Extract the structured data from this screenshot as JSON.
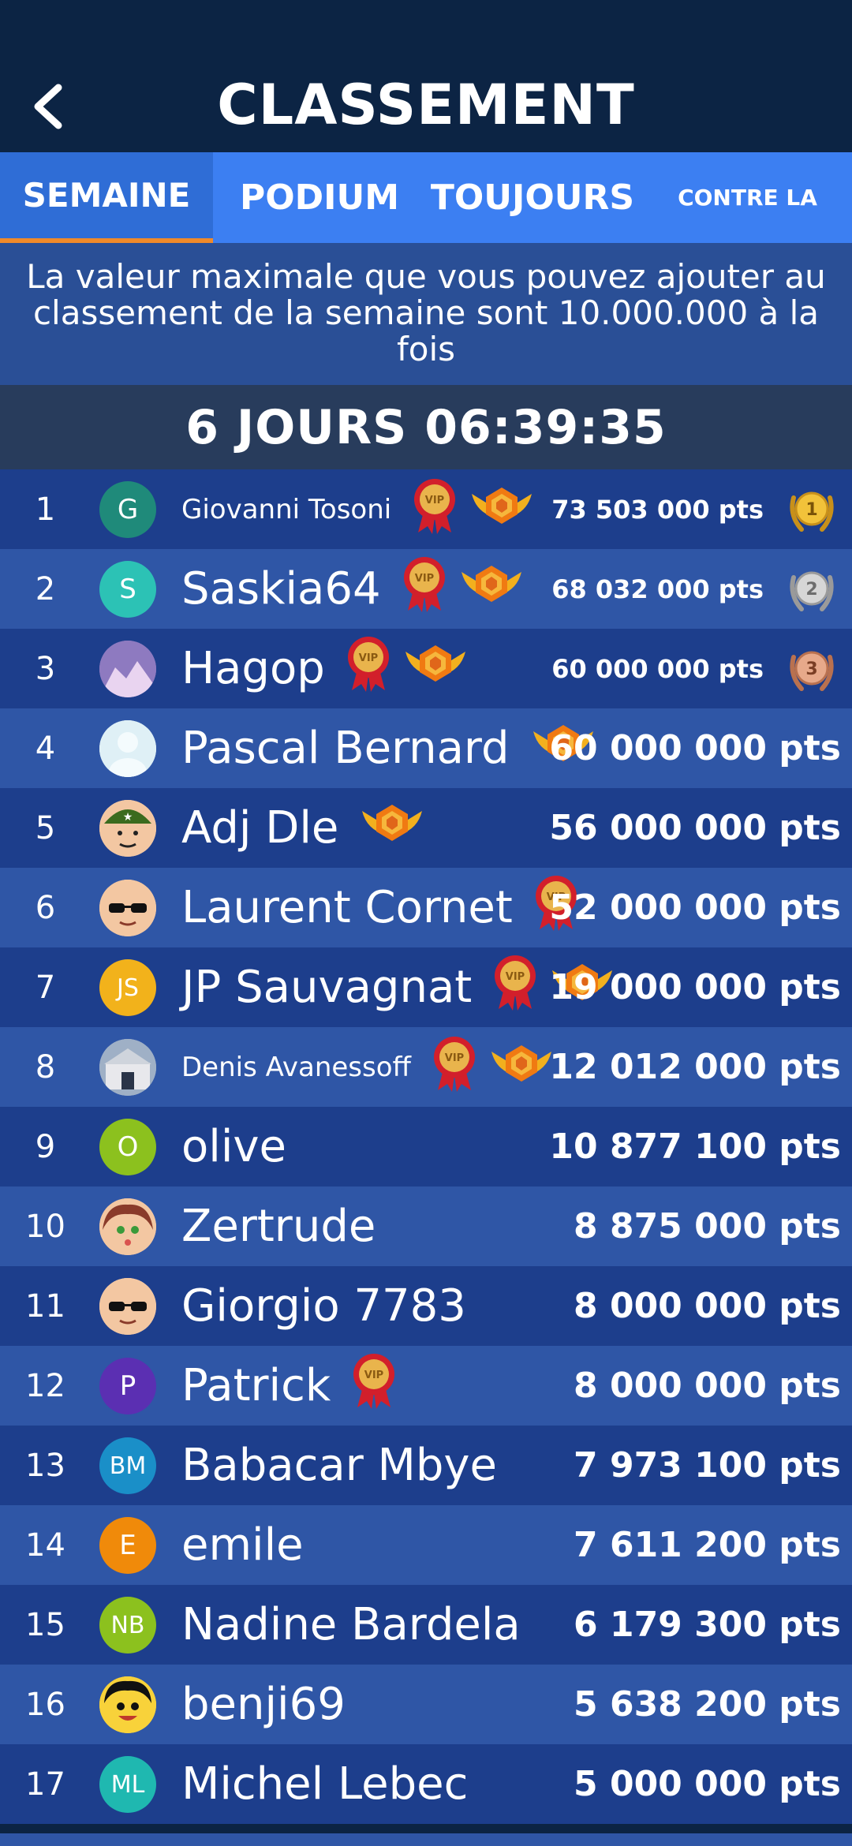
{
  "header": {
    "title": "CLASSEMENT",
    "back_icon": "chevron-left-icon"
  },
  "tabs": [
    {
      "label": "SEMAINE",
      "active": true
    },
    {
      "label": "PODIUM",
      "active": false
    },
    {
      "label": "TOUJOURS",
      "active": false
    },
    {
      "label": "CONTRE LA",
      "active": false
    }
  ],
  "info_text": "La valeur maximale que vous pouvez ajouter au classement de la semaine sont 10.000.000 à la fois",
  "timer": "6 JOURS 06:39:35",
  "colors": {
    "header_bg": "#0c2444",
    "tab_bar": "#3c7ff2",
    "tab_indicator": "#f08a2a",
    "row_dark": "#1d3e8c",
    "row_light": "#2f56a6"
  },
  "rows": [
    {
      "rank": "1",
      "initials": "G",
      "avatar_color": "#1f8a7a",
      "name": "Giovanni Tosoni",
      "vip": true,
      "crown": true,
      "points": "73 503 000 pts",
      "medal": "1"
    },
    {
      "rank": "2",
      "initials": "S",
      "avatar_color": "#2cc2b5",
      "name": "Saskia64",
      "vip": true,
      "crown": true,
      "points": "68 032 000 pts",
      "medal": "2"
    },
    {
      "rank": "3",
      "initials": "",
      "avatar_color": "#8e7ac0",
      "name": "Hagop",
      "vip": true,
      "crown": true,
      "points": "60 000 000 pts",
      "medal": "3"
    },
    {
      "rank": "4",
      "initials": "",
      "avatar_color": "#dff0f6",
      "name": "Pascal Bernard",
      "vip": false,
      "crown": true,
      "points": "60 000 000 pts"
    },
    {
      "rank": "5",
      "initials": "",
      "avatar_color": "#f3c7a2",
      "name": "Adj Dle",
      "vip": false,
      "crown": true,
      "points": "56 000 000 pts"
    },
    {
      "rank": "6",
      "initials": "",
      "avatar_color": "#f3c7a2",
      "name": "Laurent Cornet",
      "vip": true,
      "crown": false,
      "points": "52 000 000 pts"
    },
    {
      "rank": "7",
      "initials": "JS",
      "avatar_color": "#f2b21b",
      "name": "JP Sauvagnat",
      "vip": true,
      "crown": true,
      "points": "19 000 000 pts"
    },
    {
      "rank": "8",
      "initials": "",
      "avatar_color": "#9fb0c6",
      "name": "Denis Avanessoff",
      "vip": true,
      "crown": true,
      "points": "12 012 000 pts"
    },
    {
      "rank": "9",
      "initials": "O",
      "avatar_color": "#8cc11e",
      "name": "olive",
      "vip": false,
      "crown": false,
      "points": "10 877 100 pts"
    },
    {
      "rank": "10",
      "initials": "",
      "avatar_color": "#f3c7a2",
      "name": "Zertrude",
      "vip": false,
      "crown": false,
      "points": "8 875 000 pts"
    },
    {
      "rank": "11",
      "initials": "",
      "avatar_color": "#f3c7a2",
      "name": "Giorgio 7783",
      "vip": false,
      "crown": false,
      "points": "8 000 000 pts"
    },
    {
      "rank": "12",
      "initials": "P",
      "avatar_color": "#5b2fb2",
      "name": "Patrick",
      "vip": true,
      "crown": false,
      "points": "8 000 000 pts"
    },
    {
      "rank": "13",
      "initials": "BM",
      "avatar_color": "#1a8fc8",
      "name": "Babacar Mbye",
      "vip": false,
      "crown": false,
      "points": "7 973 100 pts"
    },
    {
      "rank": "14",
      "initials": "E",
      "avatar_color": "#f08a0a",
      "name": "emile",
      "vip": false,
      "crown": false,
      "points": "7 611 200 pts"
    },
    {
      "rank": "15",
      "initials": "NB",
      "avatar_color": "#8cc11e",
      "name": "Nadine Bardela",
      "vip": false,
      "crown": false,
      "points": "6 179 300 pts"
    },
    {
      "rank": "16",
      "initials": "",
      "avatar_color": "#f8d23a",
      "name": "benji69",
      "vip": false,
      "crown": false,
      "points": "5 638 200 pts"
    },
    {
      "rank": "17",
      "initials": "ML",
      "avatar_color": "#1fb8b0",
      "name": "Michel Lebec",
      "vip": false,
      "crown": false,
      "points": "5 000 000 pts"
    }
  ]
}
